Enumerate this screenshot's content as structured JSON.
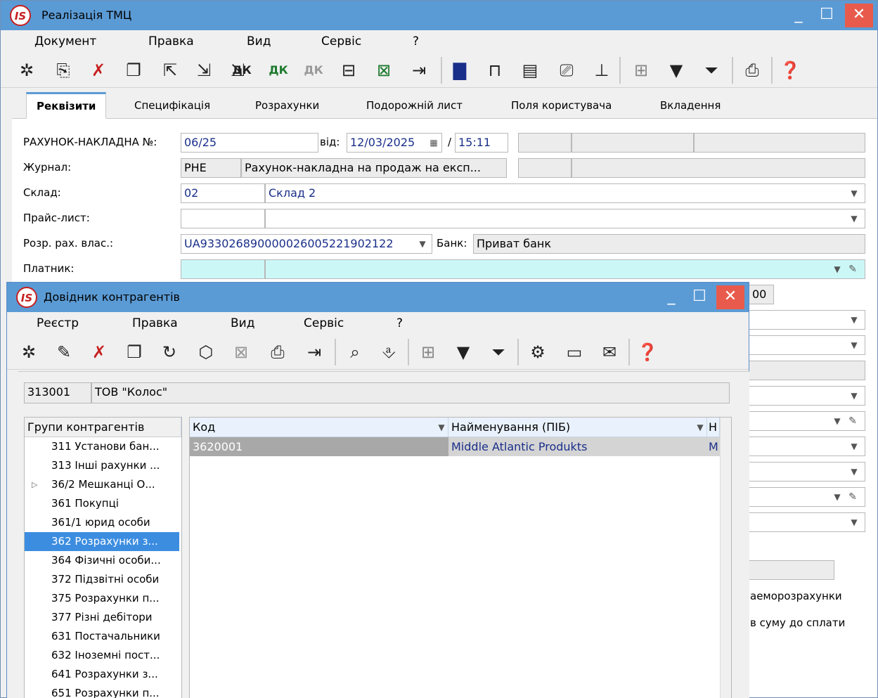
{
  "main": {
    "title": "Реалізація ТМЦ",
    "menu": [
      "Документ",
      "Правка",
      "Вид",
      "Сервіс",
      "?"
    ],
    "tabs": [
      "Реквізити",
      "Специфікація",
      "Розрахунки",
      "Подорожній лист",
      "Поля користувача",
      "Вкладення"
    ],
    "form": {
      "invoice_label": "РАХУНОК-НАКЛАДНА №:",
      "invoice_no": "06/25",
      "date_label": "від:",
      "date": "12/03/2025",
      "slash": "/",
      "time": "15:11",
      "journal_label": "Журнал:",
      "journal_code": "РНЕ",
      "journal_name": "Рахунок-накладна на продаж на експ...",
      "warehouse_label": "Склад:",
      "warehouse_code": "02",
      "warehouse_name": "Склад 2",
      "pricelist_label": "Прайс-лист:",
      "account_label": "Розр. рах. влас.:",
      "account": "UA933026890000026005221902122",
      "bank_label": "Банк:",
      "bank": "Приват банк",
      "payer_label": "Платник:",
      "partial_00": "00",
      "partial_mutual": "аеморозрахунки",
      "partial_sum": "в суму до сплати"
    }
  },
  "dialog": {
    "title": "Довідник контрагентів",
    "menu": [
      "Реєстр",
      "Правка",
      "Вид",
      "Сервіс",
      "?"
    ],
    "selected_code": "313001",
    "selected_name": "ТОВ \"Колос\"",
    "groups_header": "Групи контрагентів",
    "groups": [
      "311 Установи бан...",
      "313 Інші рахунки ...",
      "36/2 Мешканці О...",
      "361 Покупці",
      "361/1 юрид особи",
      "362 Розрахунки з...",
      "364 Фізичні особи...",
      "372 Підзвітні особи",
      "375 Розрахунки п...",
      "377 Різні дебітори",
      "631 Постачальники",
      "632 Іноземні пост...",
      "641 Розрахунки з...",
      "651 Розрахунки п..."
    ],
    "col_code": "Код",
    "col_name": "Найменування (ПІБ)",
    "col_extra": "Н",
    "row_code": "3620001",
    "row_name": "Middle Atlantic Produkts",
    "row_extra": "M"
  },
  "colors": {
    "titlebar": "#5b9bd5",
    "close": "#e85b4c",
    "selection": "#3c8de0",
    "link": "#1a2f8a",
    "payer": "#ccf7f7"
  }
}
